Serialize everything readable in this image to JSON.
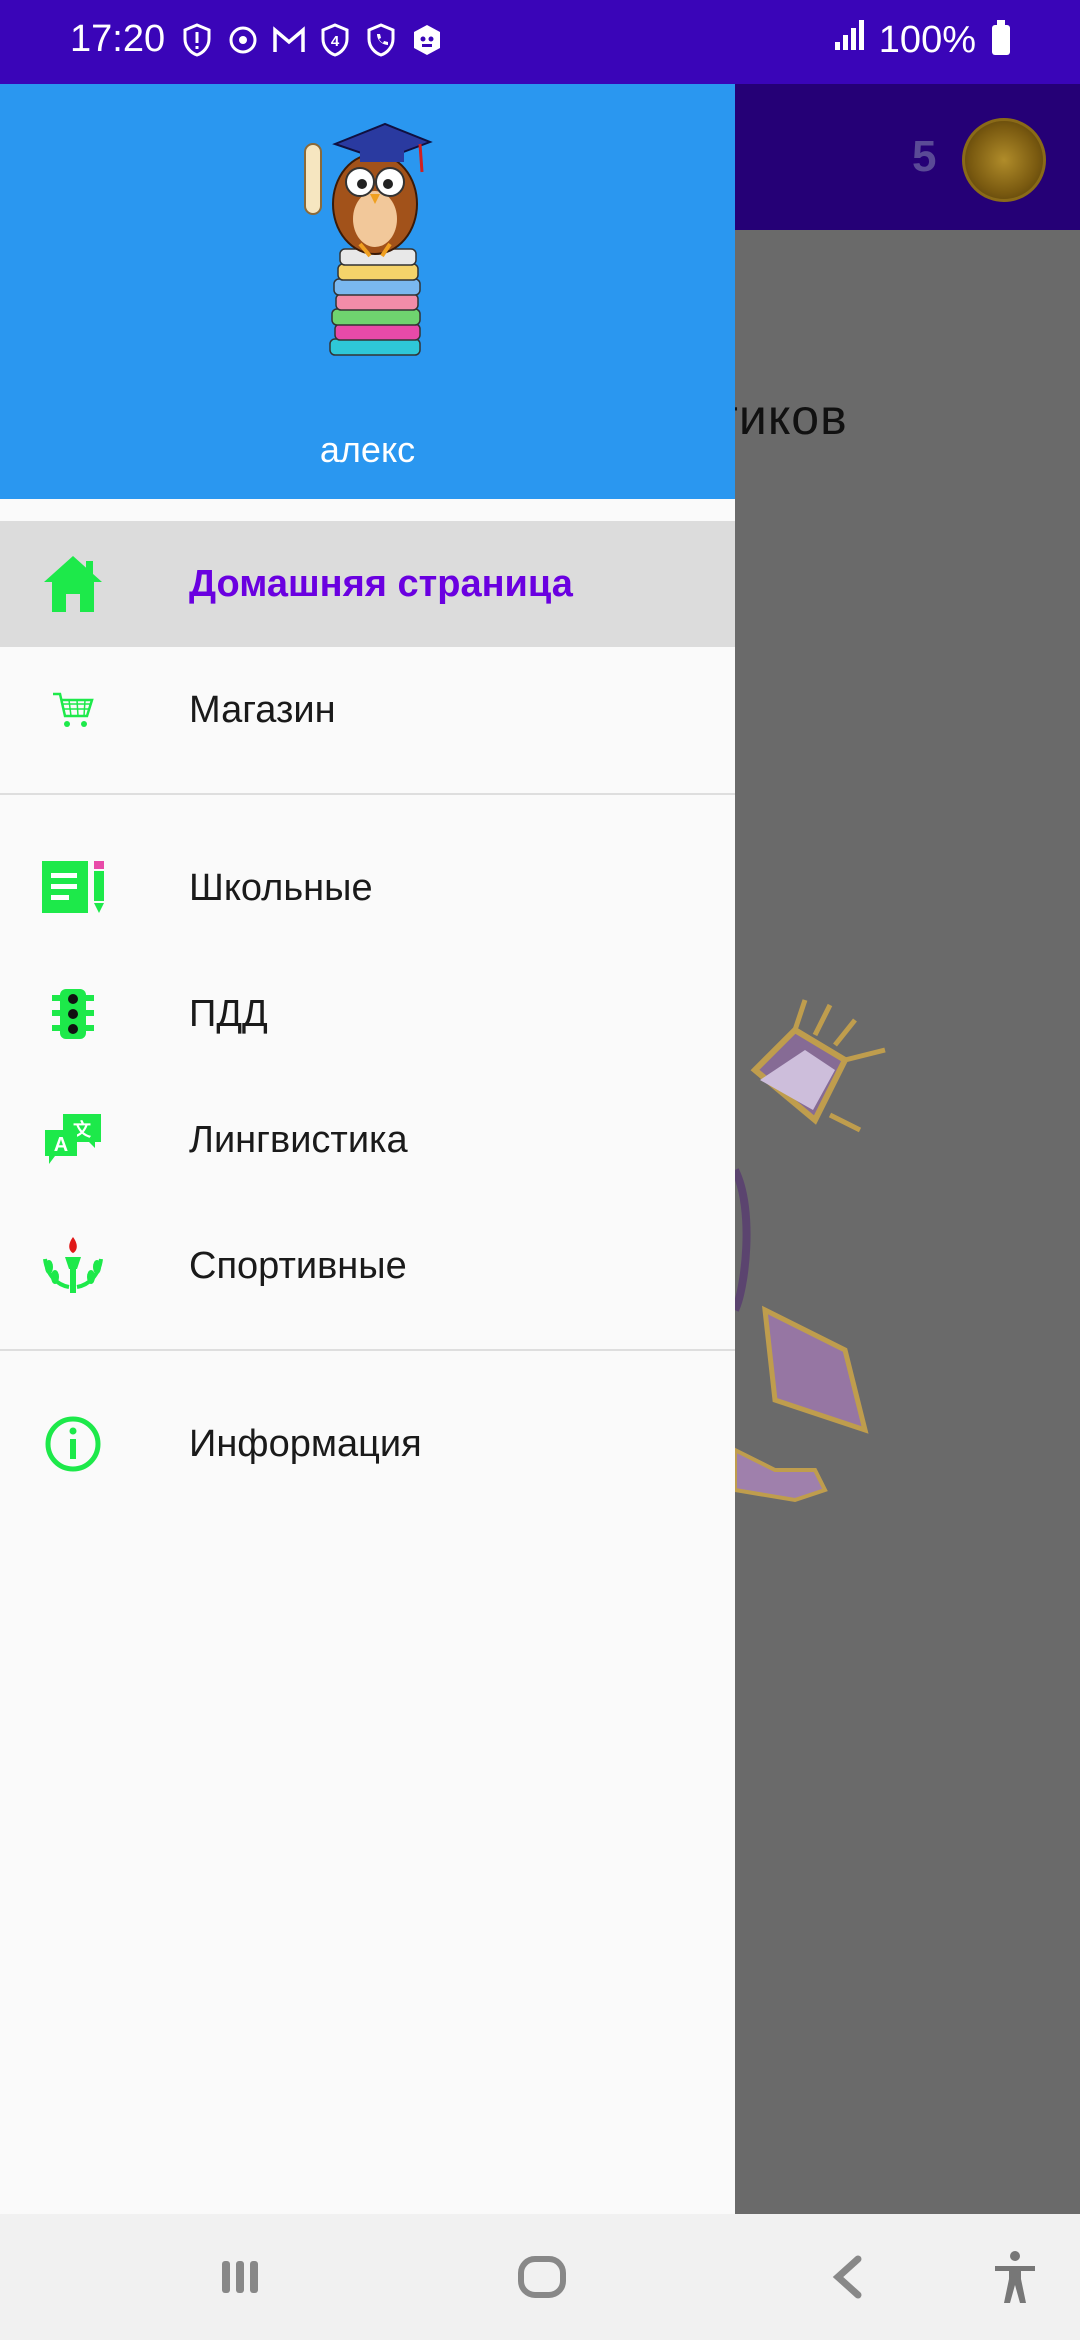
{
  "status_bar": {
    "time": "17:20",
    "battery": "100%",
    "icons": [
      "shield-alert-icon",
      "sync-icon",
      "gmail-icon",
      "shield-4-icon",
      "shield-phone-icon",
      "hexagon-icon"
    ]
  },
  "app_bar": {
    "coin_count": "5"
  },
  "background": {
    "heading_fragment": "тиков"
  },
  "drawer": {
    "username": "алекс",
    "menu": [
      {
        "label": "Домашняя страница",
        "icon": "home-icon",
        "active": true
      },
      {
        "label": "Магазин",
        "icon": "cart-icon",
        "active": false
      },
      {
        "label": "Школьные",
        "icon": "school-notes-icon",
        "active": false
      },
      {
        "label": "ПДД",
        "icon": "traffic-light-icon",
        "active": false
      },
      {
        "label": "Лингвистика",
        "icon": "translate-icon",
        "active": false
      },
      {
        "label": "Спортивные",
        "icon": "torch-laurel-icon",
        "active": false
      },
      {
        "label": "Информация",
        "icon": "info-icon",
        "active": false
      }
    ]
  },
  "colors": {
    "status_bar": "#3a05b8",
    "drawer_header": "#2a97f0",
    "accent_green": "#1de94a",
    "active_text": "#6a00e0"
  }
}
